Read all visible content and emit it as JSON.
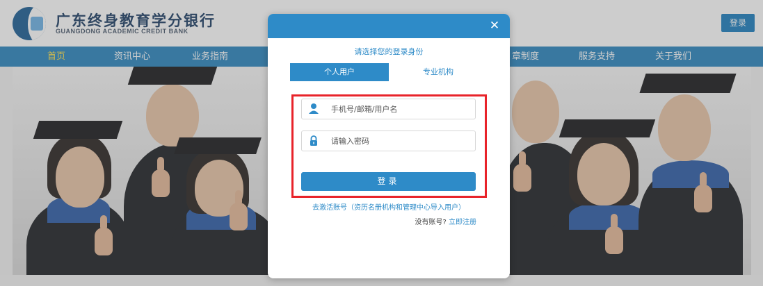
{
  "header": {
    "logo_cn": "广东终身教育学分银行",
    "logo_en": "GUANGDONG ACADEMIC CREDIT BANK",
    "login_label": "登录"
  },
  "nav": {
    "items": [
      {
        "label": "首页",
        "active": true
      },
      {
        "label": "资讯中心"
      },
      {
        "label": "业务指南"
      },
      {
        "label": "章制度"
      },
      {
        "label": "服务支持"
      },
      {
        "label": "关于我们"
      }
    ]
  },
  "modal": {
    "close_icon": "close-icon",
    "identity_prompt": "请选择您的登录身份",
    "tabs": [
      {
        "label": "个人用户",
        "active": true
      },
      {
        "label": "专业机构"
      }
    ],
    "username": {
      "placeholder": "手机号/邮箱/用户名",
      "value": "",
      "icon": "user-icon"
    },
    "password": {
      "placeholder": "请输入密码",
      "value": "",
      "icon": "lock-icon"
    },
    "login_button": "登录",
    "activate_link": "去激活账号（资历名册机构和管理中心导入用户）",
    "register_question": "没有账号?",
    "register_link": "立即注册"
  },
  "colors": {
    "primary": "#2e8bc8",
    "nav_bg": "#2c86bf",
    "nav_active": "#ffe14a",
    "highlight": "#e8232a"
  }
}
